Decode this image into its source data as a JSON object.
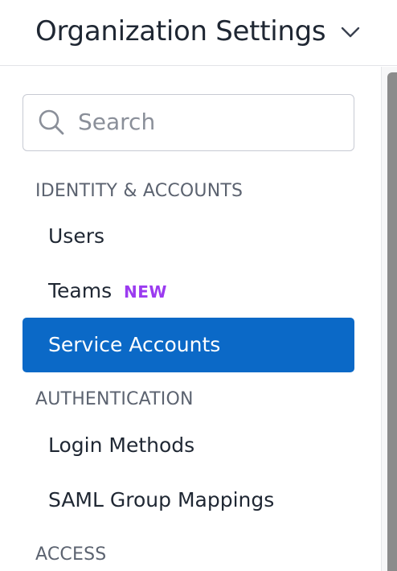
{
  "header": {
    "title": "Organization Settings",
    "chevron_icon": "chevron-down-icon"
  },
  "search": {
    "placeholder": "Search",
    "icon": "search-icon"
  },
  "sections": {
    "identity": {
      "heading": "IDENTITY & ACCOUNTS",
      "items": {
        "users": {
          "label": "Users"
        },
        "teams": {
          "label": "Teams",
          "badge": "NEW"
        },
        "service_accounts": {
          "label": "Service Accounts",
          "active": true
        }
      }
    },
    "authentication": {
      "heading": "AUTHENTICATION",
      "items": {
        "login_methods": {
          "label": "Login Methods"
        },
        "saml_group_mappings": {
          "label": "SAML Group Mappings"
        }
      }
    },
    "access": {
      "heading": "ACCESS"
    }
  },
  "colors": {
    "accent": "#0b69c7",
    "badge": "#9b3bf0",
    "text": "#1f2733",
    "muted": "#5c6370"
  }
}
